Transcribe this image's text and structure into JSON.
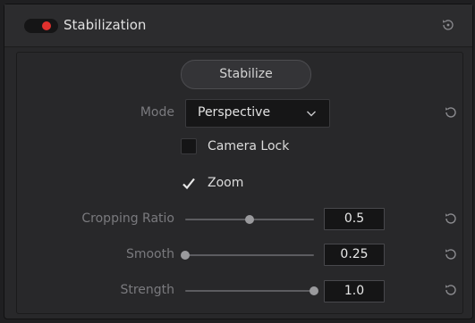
{
  "colors": {
    "toggle_dot": "#e0312e",
    "icon": "#8c8c90"
  },
  "header": {
    "title": "Stabilization",
    "enabled": true
  },
  "stabilize_button": "Stabilize",
  "mode": {
    "label": "Mode",
    "value": "Perspective"
  },
  "camera_lock": {
    "label": "Camera Lock",
    "checked": false
  },
  "zoom": {
    "label": "Zoom",
    "checked": true
  },
  "sliders": [
    {
      "label": "Cropping Ratio",
      "value": "0.5",
      "fraction": 0.5
    },
    {
      "label": "Smooth",
      "value": "0.25",
      "fraction": 0.0
    },
    {
      "label": "Strength",
      "value": "1.0",
      "fraction": 1.0
    }
  ]
}
